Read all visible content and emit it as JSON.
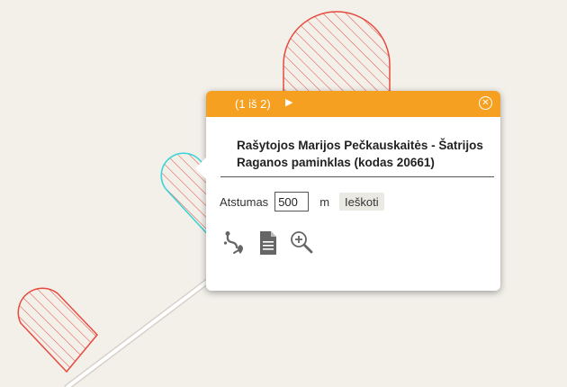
{
  "popup": {
    "pager": "(1 iš 2)",
    "title": "Rašytojos Marijos Pečkauskaitės - Šatrijos Raganos paminklas (kodas 20661)",
    "distance": {
      "label": "Atstumas",
      "value": "500",
      "unit": "m"
    },
    "search_label": "Ieškoti",
    "tool_icons": [
      "route-icon",
      "document-icon",
      "zoom-in-icon"
    ]
  },
  "colors": {
    "header": "#f5a020",
    "feature": "#e64a3e",
    "selected": "#3dd5d9",
    "map_background": "#f3f0ea",
    "icon": "#666666"
  }
}
